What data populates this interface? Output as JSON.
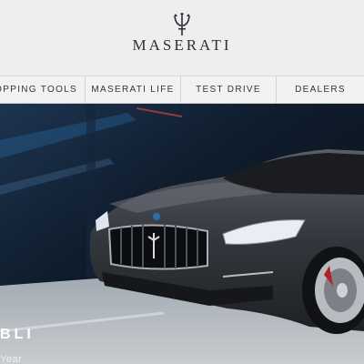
{
  "header": {
    "brand": "MASERATI",
    "logo_icon": "trident-icon"
  },
  "nav": {
    "items": [
      {
        "label": "HOPPING TOOLS"
      },
      {
        "label": "MASERATI LIFE"
      },
      {
        "label": "TEST DRIVE"
      },
      {
        "label": "DEALERS"
      }
    ]
  },
  "hero": {
    "title": "BLI",
    "subtitle": "Year",
    "image": "dark-grey-maserati-ghibli-car",
    "colors": {
      "background": "#0e1a2a",
      "accent": "#2c6fa8",
      "car_body": "#3a3d44",
      "brake_caliper": "#b3202a"
    }
  }
}
